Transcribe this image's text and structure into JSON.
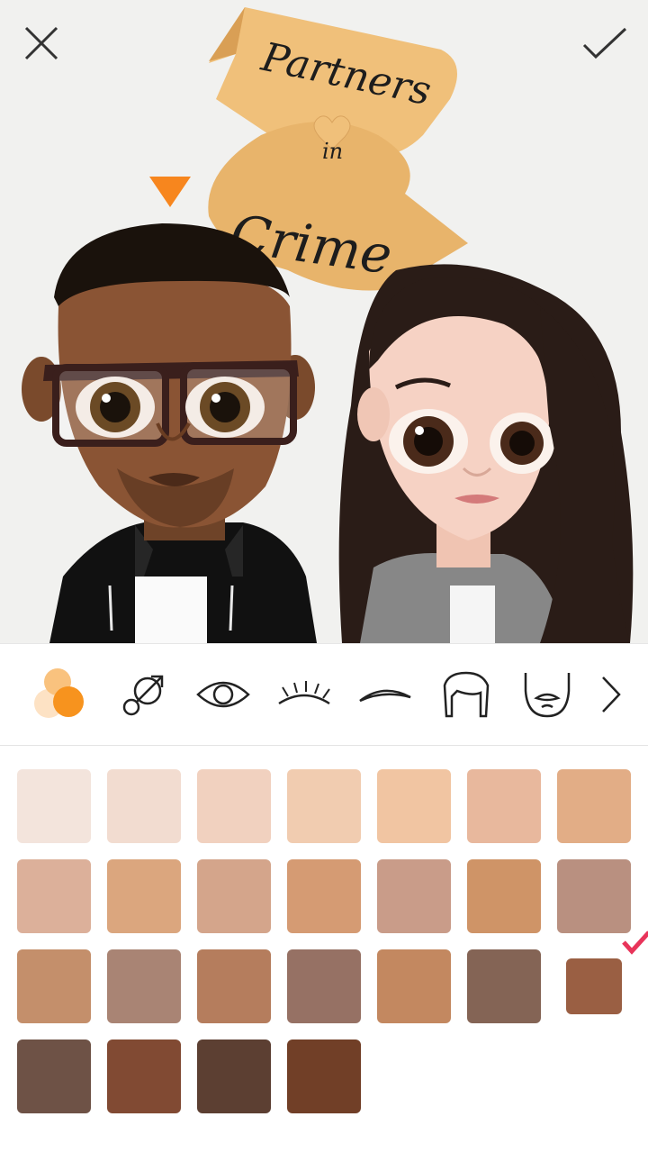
{
  "banner": {
    "line1": "Partners",
    "line2": "in",
    "line3": "Crime"
  },
  "header": {
    "close_icon": "close-icon",
    "confirm_icon": "checkmark-icon"
  },
  "toolbar": {
    "tools": [
      {
        "name": "skin-tone",
        "icon": "color-dots-icon",
        "active": true
      },
      {
        "name": "gender",
        "icon": "gender-icon"
      },
      {
        "name": "eye",
        "icon": "eye-icon"
      },
      {
        "name": "eyelashes",
        "icon": "eyelashes-icon"
      },
      {
        "name": "eyebrow",
        "icon": "eyebrow-icon"
      },
      {
        "name": "hair",
        "icon": "hair-icon"
      },
      {
        "name": "beard",
        "icon": "beard-icon"
      }
    ],
    "more_icon": "chevron-right-icon"
  },
  "skin_tones": {
    "selected_index": 20,
    "colors": [
      "#f3e4dc",
      "#f2dcd0",
      "#f1d1bf",
      "#f1ccb0",
      "#f1c5a2",
      "#e8b89d",
      "#e2ad86",
      "#dcb09a",
      "#dba67e",
      "#d4a58b",
      "#d59b73",
      "#c99c89",
      "#cf9467",
      "#b99080",
      "#c48f6b",
      "#a98474",
      "#b57d5d",
      "#967164",
      "#c38860",
      "#846455",
      "#9a5f43",
      "#6e5246",
      "#814a33",
      "#5c3f32",
      "#713f27"
    ],
    "check_color": "#e8345a"
  },
  "colors": {
    "accent": "#f7861e",
    "banner": "#f0c07a"
  }
}
